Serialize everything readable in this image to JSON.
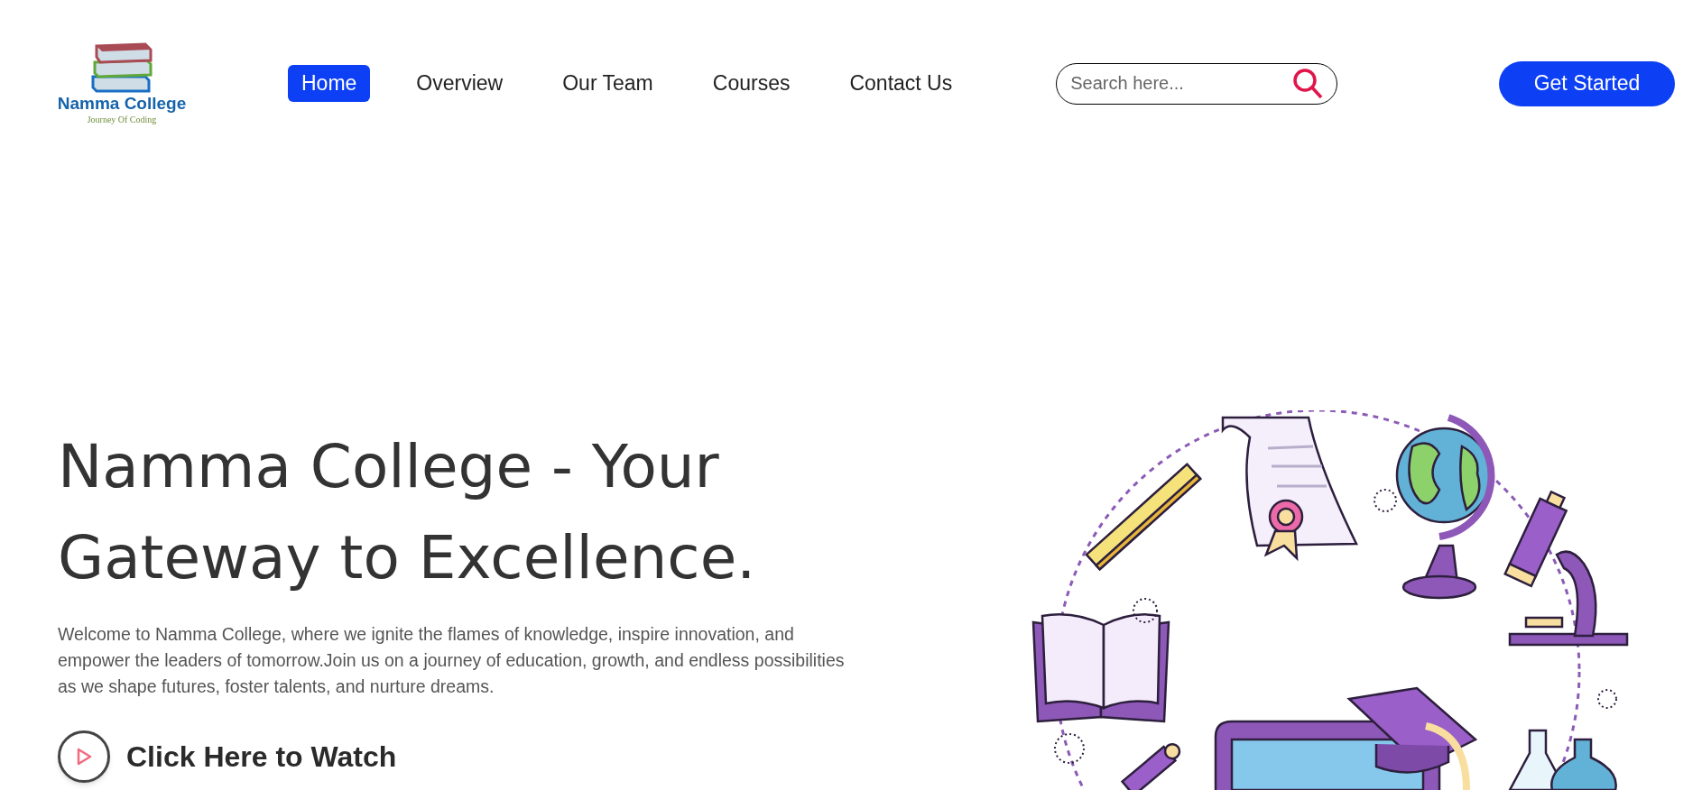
{
  "logo": {
    "title": "Namma College",
    "tagline": "Journey Of Coding"
  },
  "nav": [
    {
      "label": "Home",
      "selected": true
    },
    {
      "label": "Overview",
      "selected": false
    },
    {
      "label": "Our Team",
      "selected": false
    },
    {
      "label": "Courses",
      "selected": false
    },
    {
      "label": "Contact Us",
      "selected": false
    }
  ],
  "search": {
    "placeholder": "Search here..."
  },
  "cta": "Get Started",
  "hero": {
    "title": "Namma College - Your Gateway to Excellence.",
    "text": "Welcome to Namma College, where we ignite the flames of knowledge, inspire innovation, and empower the leaders of tomorrow.Join us on a journey of education, growth, and endless possibilities as we shape futures, foster talents, and nurture dreams.",
    "watch": "Click Here to Watch"
  }
}
